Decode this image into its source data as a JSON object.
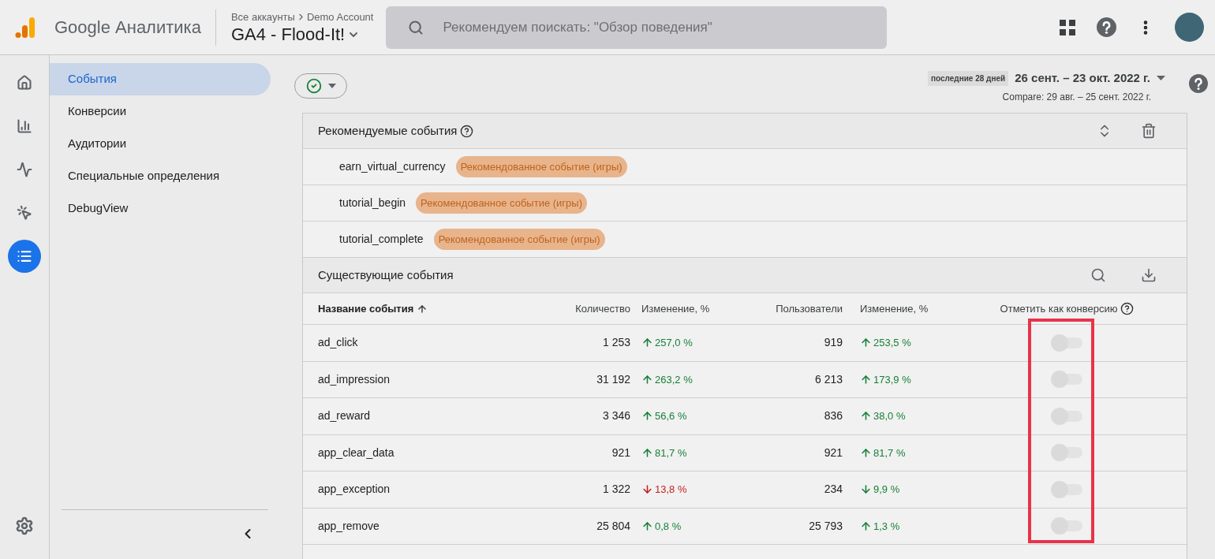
{
  "header": {
    "logo_text": "Google Аналитика",
    "breadcrumb": {
      "parent": "Все аккаунты",
      "current": "Demo Account"
    },
    "property": "GA4 - Flood-It!",
    "search_placeholder": "Рекомендуем поискать: \"Обзор поведения\""
  },
  "rail": [
    {
      "kind": "home",
      "selected": false
    },
    {
      "kind": "reports",
      "selected": false
    },
    {
      "kind": "explore",
      "selected": false
    },
    {
      "kind": "advertising",
      "selected": false
    },
    {
      "kind": "configure",
      "selected": true
    }
  ],
  "sidebar": [
    {
      "label": "События",
      "selected": true
    },
    {
      "label": "Конверсии",
      "selected": false
    },
    {
      "label": "Аудитории",
      "selected": false
    },
    {
      "label": "Специальные определения",
      "selected": false
    },
    {
      "label": "DebugView",
      "selected": false
    }
  ],
  "toolbar": {
    "period_badge": "последние 28 дней",
    "date_range": "26 сент. – 23 окт. 2022 г.",
    "compare": "Compare: 29 авг. – 25 сент. 2022 г."
  },
  "recommended": {
    "title": "Рекомендуемые события",
    "events": [
      {
        "name": "earn_virtual_currency",
        "tag": "Рекомендованное событие (игры)"
      },
      {
        "name": "tutorial_begin",
        "tag": "Рекомендованное событие (игры)"
      },
      {
        "name": "tutorial_complete",
        "tag": "Рекомендованное событие (игры)"
      }
    ]
  },
  "existing": {
    "title": "Существующие события",
    "columns": [
      "Название события",
      "Количество",
      "Изменение, %",
      "Пользователи",
      "Изменение, %",
      "Отметить как конверсию"
    ],
    "highlight_conversion_column": true,
    "rows": [
      {
        "name": "ad_click",
        "count": "1 253",
        "count_change": {
          "kind": "increase",
          "text": "257,0 %",
          "color": "#188038"
        },
        "users": "919",
        "users_change": {
          "kind": "increase",
          "text": "253,5 %",
          "color": "#188038"
        },
        "conversion": false
      },
      {
        "name": "ad_impression",
        "count": "31 192",
        "count_change": {
          "kind": "increase",
          "text": "263,2 %",
          "color": "#188038"
        },
        "users": "6 213",
        "users_change": {
          "kind": "increase",
          "text": "173,9 %",
          "color": "#188038"
        },
        "conversion": false
      },
      {
        "name": "ad_reward",
        "count": "3 346",
        "count_change": {
          "kind": "increase",
          "text": "56,6 %",
          "color": "#188038"
        },
        "users": "836",
        "users_change": {
          "kind": "increase",
          "text": "38,0 %",
          "color": "#188038"
        },
        "conversion": false
      },
      {
        "name": "app_clear_data",
        "count": "921",
        "count_change": {
          "kind": "increase",
          "text": "81,7 %",
          "color": "#188038"
        },
        "users": "921",
        "users_change": {
          "kind": "increase",
          "text": "81,7 %",
          "color": "#188038"
        },
        "conversion": false
      },
      {
        "name": "app_exception",
        "count": "1 322",
        "count_change": {
          "kind": "decrease",
          "text": "13,8 %",
          "color": "#c5221f"
        },
        "users": "234",
        "users_change": {
          "kind": "decrease",
          "text": "9,9 %",
          "color": "#188038"
        },
        "conversion": false
      },
      {
        "name": "app_remove",
        "count": "25 804",
        "count_change": {
          "kind": "increase",
          "text": "0,8 %",
          "color": "#188038"
        },
        "users": "25 793",
        "users_change": {
          "kind": "increase",
          "text": "1,3 %",
          "color": "#188038"
        },
        "conversion": false
      }
    ]
  }
}
